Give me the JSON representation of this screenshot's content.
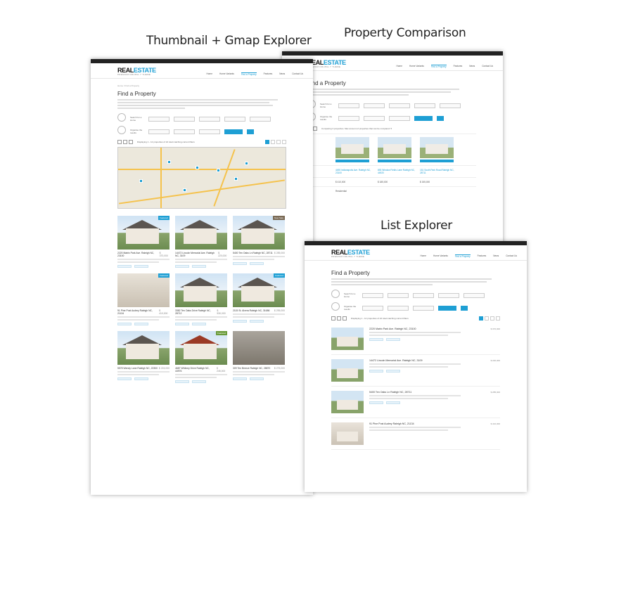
{
  "captions": {
    "thumbnail": "Thumbnail + Gmap Explorer",
    "comparison": "Property Comparison",
    "list": "List Explorer"
  },
  "site": {
    "logo_main": "REAL",
    "logo_accent": "ESTATE",
    "logo_tagline": "PREMIUM DRUPAL 7 THEME",
    "nav": [
      "Home",
      "Home Variants",
      "Find a Property",
      "Features",
      "News",
      "Contact Us"
    ],
    "page_title": "Find a Property",
    "breadcrumb": "Home / Find a Property",
    "filter_labels": {
      "search": "Search for a Home",
      "organise": "Organise the results"
    },
    "filter_fields": [
      "Property Type",
      "Bedrooms",
      "Bathrooms",
      "Agent",
      "Status"
    ],
    "apply_button": "Apply Filters & Sort",
    "reset_button": "Reset",
    "results_text": "Displaying 1 - 12 properties of 24 total matching current filters"
  },
  "thumb_cards": [
    {
      "title": "2220 Matrix Park Ave. Raleigh NC, 23100",
      "price": "$ 370,000",
      "tag": "Featured"
    },
    {
      "title": "14472 Lincoln Memorial Ave. Raleigh NC, 3109",
      "price": "$ 220,000",
      "tag": ""
    },
    {
      "title": "5400 Ten Oaks Ln Raleigh NC, 28711",
      "price": "$ 285,000",
      "tag": "New Sale"
    },
    {
      "title": "91 Pine Post Audrey Raleigh NC, 21134",
      "price": "$ 410,000",
      "tag": "Featured"
    },
    {
      "title": "3382 Ten Oaks Drive Raleigh NC, 28712",
      "price": "$ 530,000",
      "tag": ""
    },
    {
      "title": "2115 St. Alvera Raleigh NC, 31686",
      "price": "$ 295,000",
      "tag": "Featured"
    },
    {
      "title": "5578 Wendy Lane Raleigh NC, 22300",
      "price": "$ 215,000",
      "tag": ""
    },
    {
      "title": "4687 Whitney Drive Raleigh NC, 44976",
      "price": "$ 245,000",
      "tag": "Featured"
    },
    {
      "title": "309 Ten Breeze Raleigh NC, 28870",
      "price": "$ 275,000",
      "tag": ""
    }
  ],
  "comparison": {
    "properties": [
      {
        "address": "4495 Indianapolis Ave. Raleigh NC, 23100",
        "price": "$ 410,000",
        "remove": "Remove from compare"
      },
      {
        "address": "893 Window Fields Lane Raleigh NC, 44920",
        "price": "$ 185,000",
        "remove": "Remove from compare"
      },
      {
        "address": "151 South Park Road Raleigh NC, 28711",
        "price": "$ 155,000",
        "remove": "Remove from compare"
      }
    ],
    "status_row": "Residential",
    "compare_text": "Comparing 3 properties. Max amount of properties that can be compared: 5"
  },
  "list_rows": [
    {
      "title": "2220 Matrix Park Ave. Raleigh NC, 23100",
      "price": "$ 370,000",
      "tag": "Featured"
    },
    {
      "title": "14472 Lincoln Memorial Ave. Raleigh NC, 3109",
      "price": "$ 220,000",
      "tag": ""
    },
    {
      "title": "5400 Ten Oaks Ln Raleigh NC, 28711",
      "price": "$ 285,000",
      "tag": "New Sale"
    },
    {
      "title": "91 Pine Post Audrey Raleigh NC, 21134",
      "price": "$ 410,000",
      "tag": ""
    }
  ]
}
